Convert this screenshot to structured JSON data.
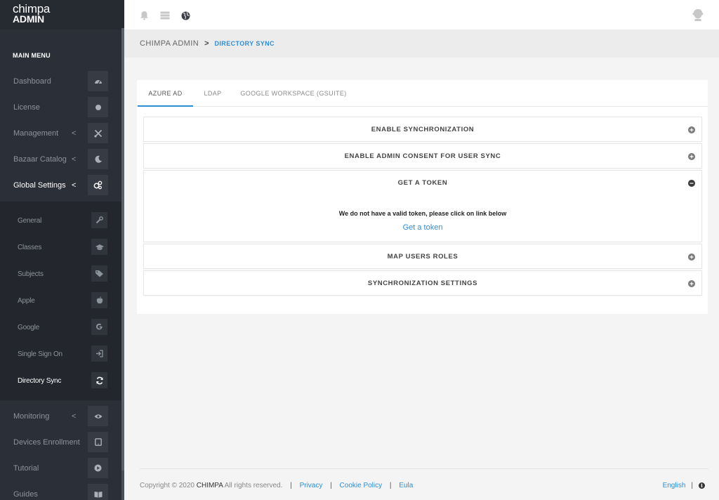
{
  "brand": {
    "line1": "chimpa",
    "line2": "ADMIN"
  },
  "sidebar": {
    "menu_title": "MAIN MENU",
    "items": [
      {
        "label": "Dashboard",
        "icon": "dashboard-icon",
        "chevron": ""
      },
      {
        "label": "License",
        "icon": "circle-icon",
        "chevron": ""
      },
      {
        "label": "Management",
        "icon": "tools-icon",
        "chevron": "<"
      },
      {
        "label": "Bazaar Catalog",
        "icon": "moon-icon",
        "chevron": "<"
      },
      {
        "label": "Global Settings",
        "icon": "gears-icon",
        "chevron": "<"
      },
      {
        "label": "Monitoring",
        "icon": "eye-icon",
        "chevron": "<"
      },
      {
        "label": "Devices Enrollment",
        "icon": "tablet-icon",
        "chevron": ""
      },
      {
        "label": "Tutorial",
        "icon": "play-icon",
        "chevron": ""
      },
      {
        "label": "Guides",
        "icon": "book-icon",
        "chevron": ""
      }
    ],
    "submenu": [
      {
        "label": "General",
        "icon": "wrench-icon"
      },
      {
        "label": "Classes",
        "icon": "graduation-cap-icon"
      },
      {
        "label": "Subjects",
        "icon": "tags-icon"
      },
      {
        "label": "Apple",
        "icon": "apple-icon"
      },
      {
        "label": "Google",
        "icon": "google-icon"
      },
      {
        "label": "Single Sign On",
        "icon": "sign-in-icon"
      },
      {
        "label": "Directory Sync",
        "icon": "refresh-icon"
      }
    ]
  },
  "breadcrumb": {
    "root": "CHIMPA ADMIN",
    "separator": ">",
    "current": "DIRECTORY SYNC"
  },
  "tabs": [
    {
      "label": "AZURE AD",
      "active": true
    },
    {
      "label": "LDAP",
      "active": false
    },
    {
      "label": "GOOGLE WORKSPACE (GSUITE)",
      "active": false
    }
  ],
  "panels": [
    {
      "title": "ENABLE SYNCHRONIZATION",
      "expanded": false
    },
    {
      "title": "ENABLE ADMIN CONSENT FOR USER SYNC",
      "expanded": false
    },
    {
      "title": "GET A TOKEN",
      "expanded": true,
      "message": "We do not have a valid token, please click on link below",
      "link": "Get a token"
    },
    {
      "title": "MAP USERS ROLES",
      "expanded": false
    },
    {
      "title": "SYNCHRONIZATION SETTINGS",
      "expanded": false
    }
  ],
  "footer": {
    "copyright_prefix": "Copyright © 2020",
    "company": "CHIMPA",
    "rights": "All rights reserved.",
    "sep": "|",
    "privacy": "Privacy",
    "cookie": "Cookie Policy",
    "eula": "Eula",
    "language": "English"
  },
  "colors": {
    "accent": "#2c8ed1",
    "sidebar": "#2b3038",
    "submenu": "#23272d"
  }
}
